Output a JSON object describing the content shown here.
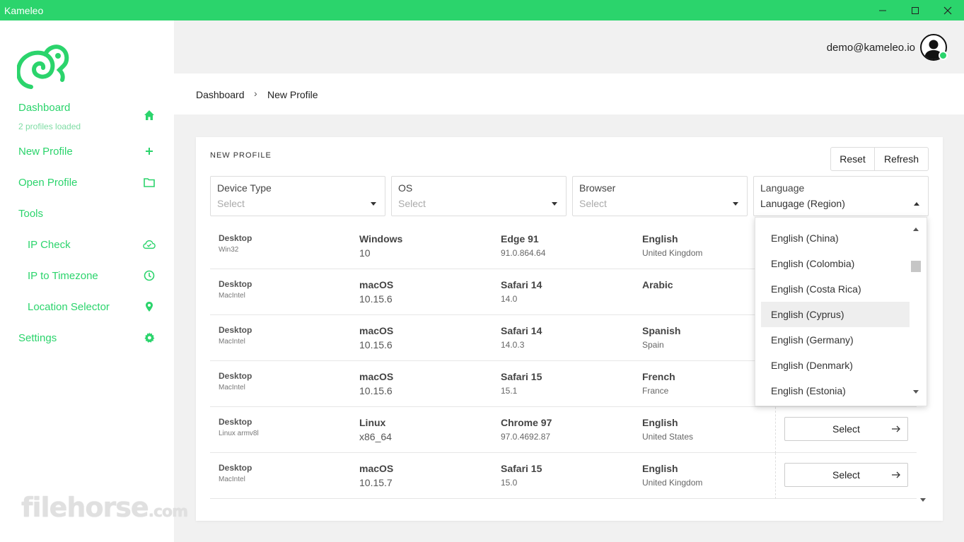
{
  "window": {
    "title": "Kameleo",
    "controls": [
      "minimize-icon",
      "maximize-icon",
      "close-icon"
    ]
  },
  "sidebar": {
    "items": [
      {
        "label": "Dashboard",
        "sub": "2 profiles loaded",
        "icon": "home-icon"
      },
      {
        "label": "New Profile",
        "icon": "plus-icon"
      },
      {
        "label": "Open Profile",
        "icon": "folder-icon"
      },
      {
        "label": "Tools"
      },
      {
        "label": "IP Check",
        "icon": "cloud-check-icon"
      },
      {
        "label": "IP to Timezone",
        "icon": "clock-icon"
      },
      {
        "label": "Location Selector",
        "icon": "map-pin-icon"
      },
      {
        "label": "Settings",
        "icon": "gear-icon"
      }
    ],
    "watermark": "filehorse",
    "watermark_suffix": ".com"
  },
  "header": {
    "user_email": "demo@kameleo.io"
  },
  "breadcrumb": {
    "items": [
      "Dashboard",
      "New Profile"
    ],
    "separator": "›"
  },
  "card": {
    "title": "NEW PROFILE",
    "reset_label": "Reset",
    "refresh_label": "Refresh"
  },
  "filters": [
    {
      "label": "Device Type",
      "value": "Select"
    },
    {
      "label": "OS",
      "value": "Select"
    },
    {
      "label": "Browser",
      "value": "Select"
    },
    {
      "label": "Language",
      "value": "Lanugage (Region)"
    }
  ],
  "table": {
    "select_label": "Select",
    "rows": [
      {
        "device": "Desktop",
        "platform": "Win32",
        "os": "Windows",
        "os_version": "10",
        "browser": "Edge 91",
        "browser_version": "91.0.864.64",
        "language": "English",
        "region": "United Kingdom"
      },
      {
        "device": "Desktop",
        "platform": "MacIntel",
        "os": "macOS",
        "os_version": "10.15.6",
        "browser": "Safari 14",
        "browser_version": "14.0",
        "language": "Arabic",
        "region": ""
      },
      {
        "device": "Desktop",
        "platform": "MacIntel",
        "os": "macOS",
        "os_version": "10.15.6",
        "browser": "Safari 14",
        "browser_version": "14.0.3",
        "language": "Spanish",
        "region": "Spain"
      },
      {
        "device": "Desktop",
        "platform": "MacIntel",
        "os": "macOS",
        "os_version": "10.15.6",
        "browser": "Safari 15",
        "browser_version": "15.1",
        "language": "French",
        "region": "France"
      },
      {
        "device": "Desktop",
        "platform": "Linux armv8l",
        "os": "Linux",
        "os_version": "x86_64",
        "browser": "Chrome 97",
        "browser_version": "97.0.4692.87",
        "language": "English",
        "region": "United States"
      },
      {
        "device": "Desktop",
        "platform": "MacIntel",
        "os": "macOS",
        "os_version": "10.15.7",
        "browser": "Safari 15",
        "browser_version": "15.0",
        "language": "English",
        "region": "United Kingdom"
      }
    ]
  },
  "language_dropdown": {
    "options": [
      "English (China)",
      "English (Colombia)",
      "English (Costa Rica)",
      "English (Cyprus)",
      "English (Germany)",
      "English (Denmark)",
      "English (Estonia)"
    ],
    "hovered": "English (Cyprus)"
  },
  "colors": {
    "accent": "#2bd46c",
    "background": "#f1f1f1",
    "card": "#ffffff"
  }
}
